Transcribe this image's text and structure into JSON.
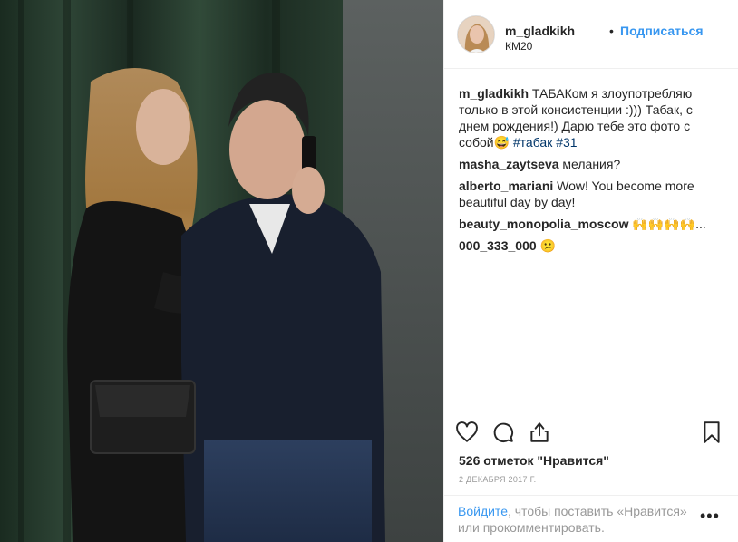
{
  "post": {
    "username": "m_gladkikh",
    "separator": "•",
    "follow_label": "Подписаться",
    "location": "КМ20",
    "caption": {
      "username": "m_gladkikh",
      "text": "ТАБАКом я злоупотребляю только в этой консистенции :))) Табак, с днем рождения!) Дарю тебе это фото с собой😅",
      "hashtags": [
        "#табак",
        "#31"
      ]
    },
    "comments": [
      {
        "username": "masha_zaytseva",
        "text": "мелания?"
      },
      {
        "username": "alberto_mariani",
        "text": "Wow! You become more beautiful day by day!"
      },
      {
        "username": "beauty_monopolia_moscow",
        "text": "🙌🙌🙌🙌..."
      },
      {
        "username": "000_333_000",
        "text": "😕"
      }
    ],
    "likes": "526 отметок \"Нравится\"",
    "date": "2 ДЕКАБРЯ 2017 Г."
  },
  "footer": {
    "login_link": "Войдите",
    "login_text": ", чтобы поставить «Нравится» или прокомментировать.",
    "more": "•••"
  },
  "icons": {
    "like": "heart-icon",
    "comment": "comment-icon",
    "share": "share-icon",
    "save": "bookmark-icon"
  },
  "colors": {
    "link": "#3897f0",
    "hashtag": "#003569",
    "muted": "#999999"
  }
}
